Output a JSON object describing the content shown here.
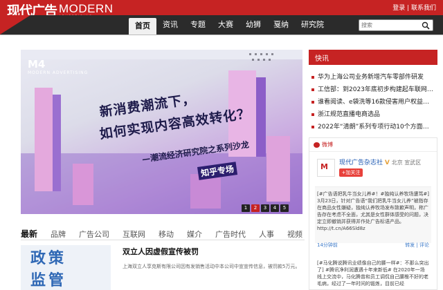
{
  "header": {
    "logo_cn": "现代广告",
    "logo_en": "MODERN",
    "logo_en_small": "ADVERTISING",
    "login": "登录",
    "contact": "联系我们",
    "brand_color": "#c62323"
  },
  "nav": {
    "items": [
      "首页",
      "资讯",
      "专题",
      "大赛",
      "幼狮",
      "戛纳",
      "研究院"
    ],
    "active": "首页",
    "search_placeholder": "搜索"
  },
  "banner": {
    "logo": "M4",
    "logo_small": "MODERN ADVERTISING",
    "title_line1": "新消费潮流下，",
    "title_line2": "如何实现内容高效转化？",
    "subtitle": "—潮流经济研究院之系列沙龙",
    "tag": "知乎专场",
    "pages": [
      "1",
      "2",
      "3",
      "4",
      "5"
    ],
    "active_page": "2"
  },
  "latest": {
    "tabs": [
      "最新",
      "品牌",
      "广告公司",
      "互联网",
      "移动",
      "媒介",
      "广告时代",
      "人事",
      "视频"
    ],
    "active_tab": "最新",
    "article": {
      "thumb_text": "政策\n监管",
      "title": "双立人因虚假宣传被罚",
      "desc": "上海双立人享克斯有限公司因有发销售活动中本公司中宣宣传信息，被罚款5万元。"
    }
  },
  "kuaixun": {
    "title": "快讯",
    "items": [
      "华为上海公司业务新增汽车零部件研发",
      "工信部：到2023年底初步构建起车联网网络...",
      "谁看阅读、e袋洗等16款侵害用户权益的App...",
      "浙江规范直播电商选品",
      "2022年“清朗”系列专项行动10个方面重点任务"
    ]
  },
  "weibo": {
    "title": "微博",
    "account_name": "现代广告杂志社",
    "location": "北京 宣武区",
    "follow": "+加关注",
    "post_text": "[#广告语把乳牛当女儿养#！#独纯认养牧场遭骂#] 3月23日，针对广告语“我们把乳牛当女儿养”被指存在商品女性嫌疑，独纯认养牧场发布致歉声明，称广告存在考虑不全面，尤其是女性群体感受的问题，决定立即撤销并获得并作处广告标语产品。http://t.cn/A66Sld8z",
    "post_time": "14分钟前",
    "actions": "转发 | 评论",
    "post2_text": "[#马化腾说腾讯业绩像自己的腰一样#：不那么突出了] #腾讯净利润遭遇十年来新低# 在2020年一场线上交流中，马化腾曾和员工调侃自己腰椎不好的老毛病，经过了一年时间的锻炼，目前已经"
  }
}
